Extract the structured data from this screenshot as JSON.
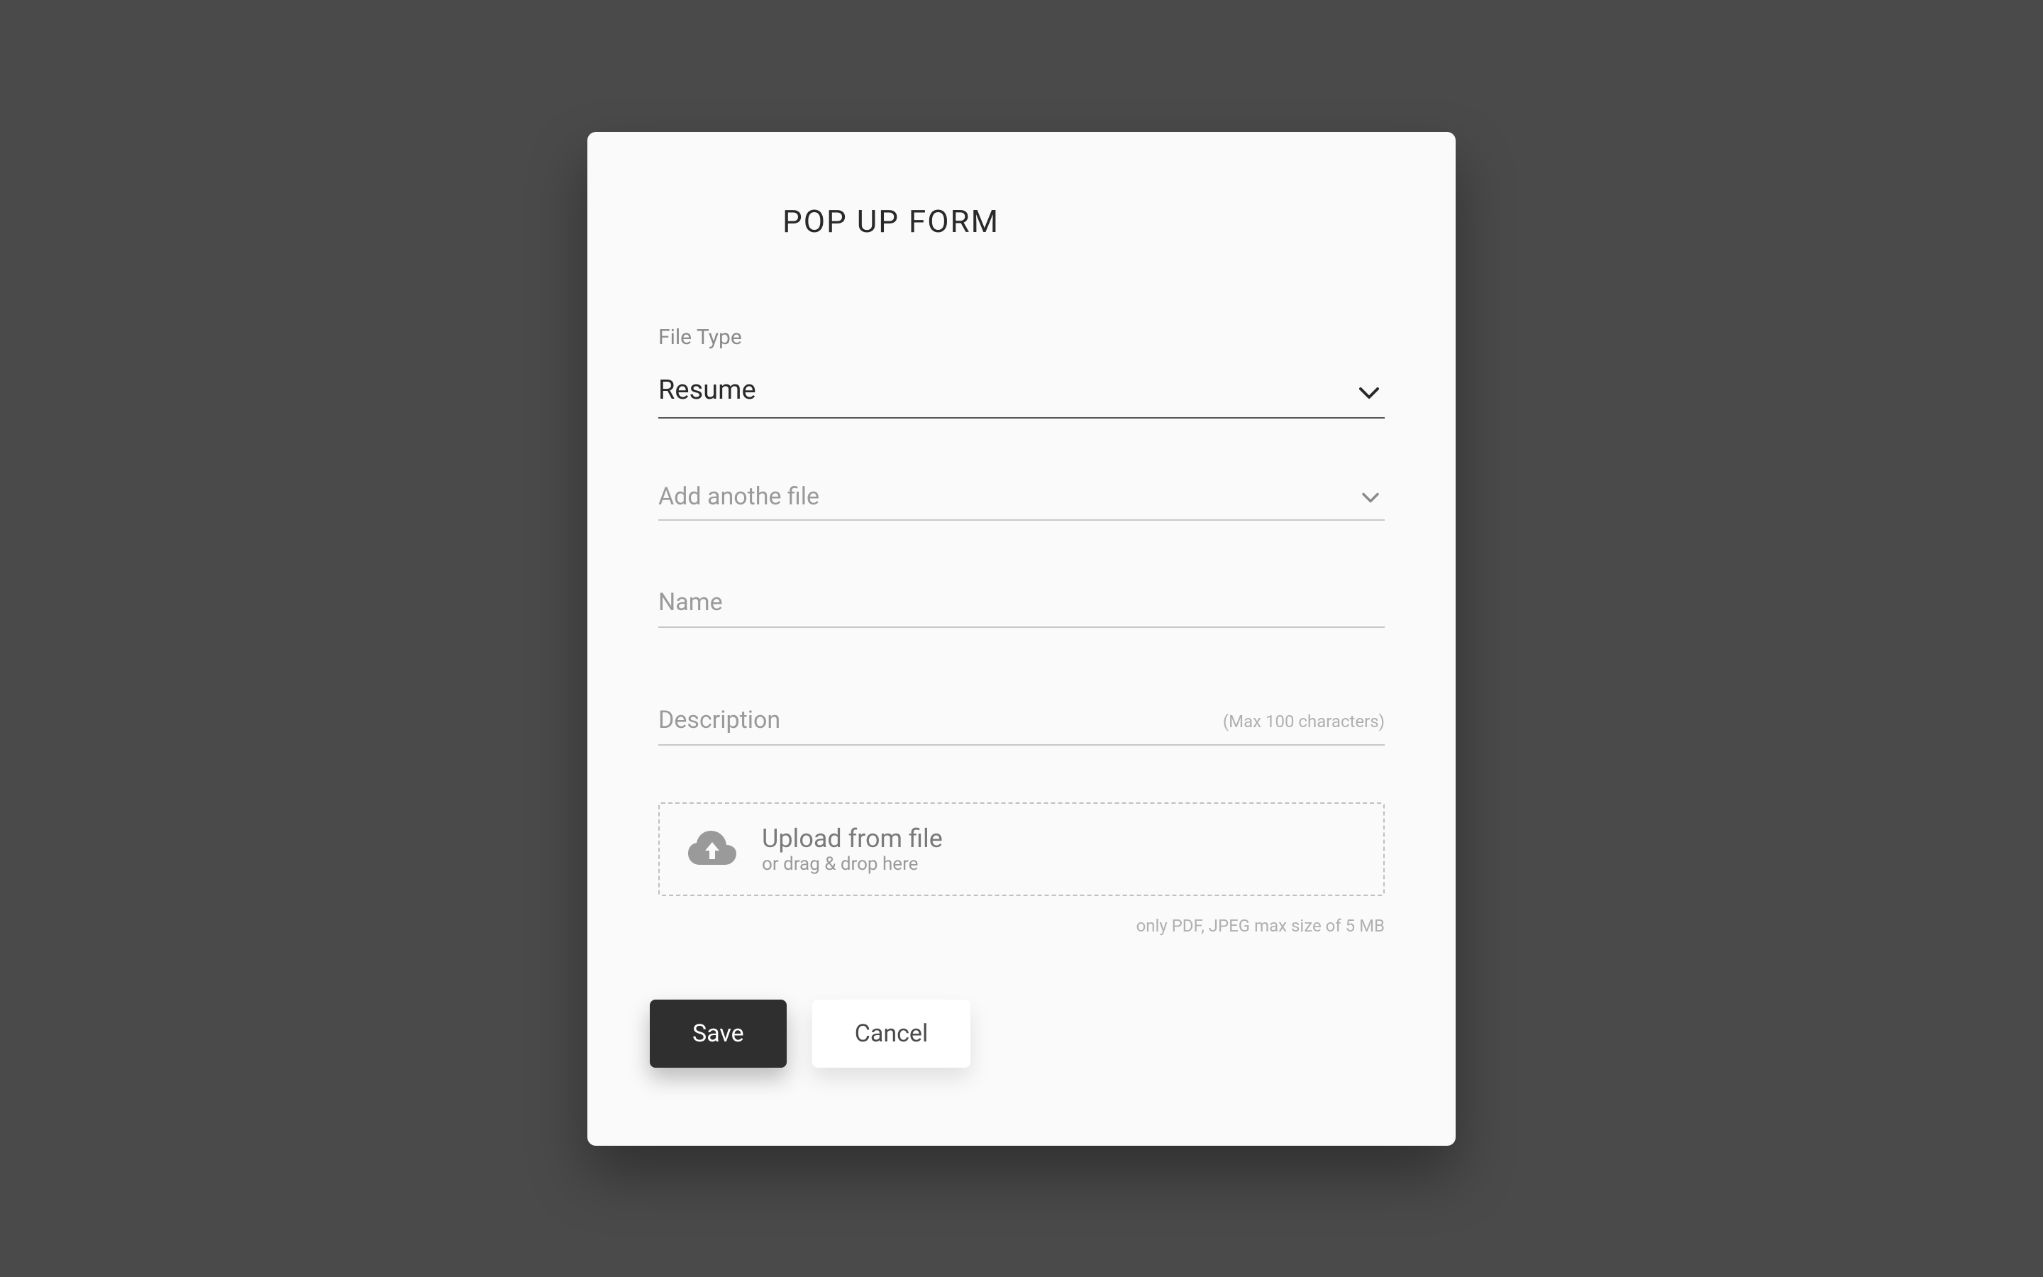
{
  "modal": {
    "title": "POP UP FORM",
    "fields": {
      "file_type": {
        "label": "File Type",
        "value": "Resume"
      },
      "add_file": {
        "placeholder": "Add anothe file"
      },
      "name": {
        "placeholder": "Name"
      },
      "description": {
        "placeholder": "Description",
        "helper": "(Max 100 characters)"
      },
      "upload": {
        "title": "Upload from file",
        "subtitle": "or drag & drop here",
        "hint": "only PDF, JPEG max size of 5 MB"
      }
    },
    "buttons": {
      "save": "Save",
      "cancel": "Cancel"
    }
  }
}
